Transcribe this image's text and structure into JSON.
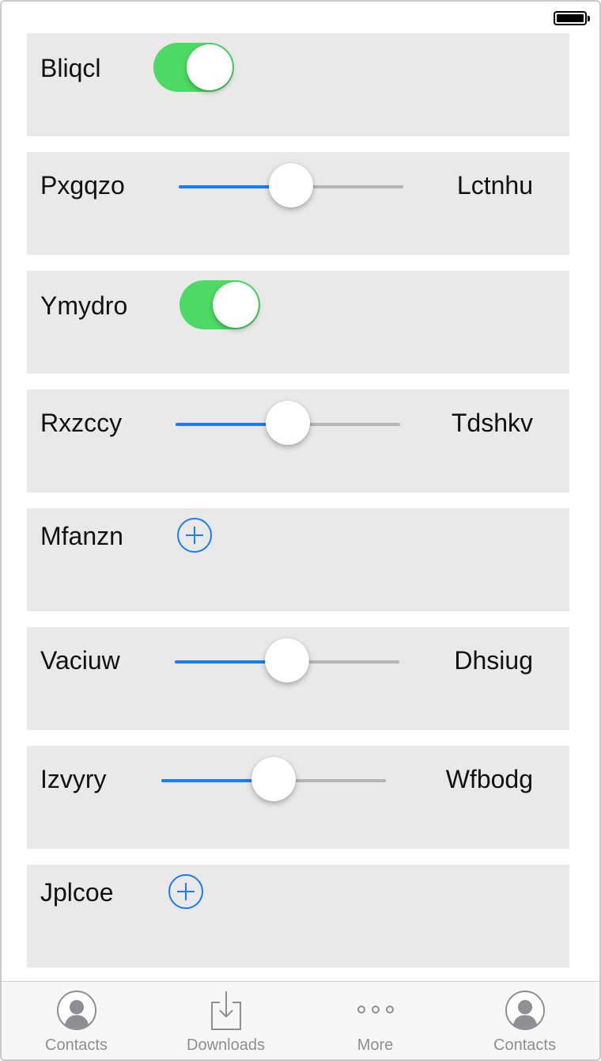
{
  "status_bar": {
    "battery_icon": "battery-full-icon"
  },
  "rows": [
    {
      "type": "toggle",
      "label": "Bliqcl",
      "toggle_on": true
    },
    {
      "type": "slider",
      "label": "Pxgqzo",
      "value_label": "Lctnhu",
      "slider_value": 0.5
    },
    {
      "type": "toggle",
      "label": "Ymydro",
      "toggle_on": true
    },
    {
      "type": "slider",
      "label": "Rxzccy",
      "value_label": "Tdshkv",
      "slider_value": 0.5
    },
    {
      "type": "add",
      "label": "Mfanzn",
      "icon": "add-circle-icon"
    },
    {
      "type": "slider",
      "label": "Vaciuw",
      "value_label": "Dhsiug",
      "slider_value": 0.5
    },
    {
      "type": "slider",
      "label": "Izvyry",
      "value_label": "Wfbodg",
      "slider_value": 0.5
    },
    {
      "type": "add",
      "label": "Jplcoe",
      "icon": "add-circle-icon"
    }
  ],
  "tab_bar": {
    "tabs": [
      {
        "label": "Contacts",
        "icon": "contacts-icon"
      },
      {
        "label": "Downloads",
        "icon": "downloads-icon"
      },
      {
        "label": "More",
        "icon": "more-icon"
      },
      {
        "label": "Contacts",
        "icon": "contacts-icon"
      }
    ]
  },
  "colors": {
    "accent": "#1b7cf2",
    "toggle_on": "#4cd964",
    "row_background": "#e9e9e9",
    "tab_label": "#8e8e93"
  }
}
